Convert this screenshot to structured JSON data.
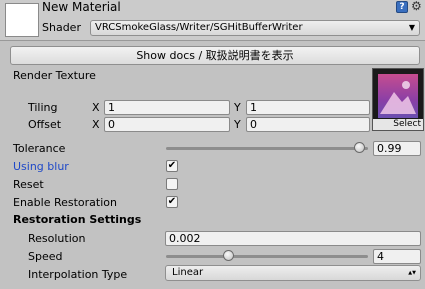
{
  "header": {
    "title": "New Material",
    "shader_label": "Shader",
    "shader_value": "VRCSmokeGlass/Writer/SGHitBufferWriter",
    "help_icon": "?"
  },
  "docs_button": "Show docs / 取扱説明書を表示",
  "render_texture": {
    "label": "Render Texture",
    "select": "Select",
    "tiling_label": "Tiling",
    "offset_label": "Offset",
    "tiling": {
      "x_label": "X",
      "x": "1",
      "y_label": "Y",
      "y": "1"
    },
    "offset": {
      "x_label": "X",
      "x": "0",
      "y_label": "Y",
      "y": "0"
    }
  },
  "tolerance": {
    "label": "Tolerance",
    "value": "0.99",
    "level": 0.99
  },
  "using_blur": {
    "label": "Using blur",
    "checked": true,
    "color": "#1f49c8"
  },
  "reset": {
    "label": "Reset",
    "checked": false
  },
  "enable_restoration": {
    "label": "Enable Restoration",
    "checked": true
  },
  "restoration_settings": {
    "heading": "Restoration Settings",
    "resolution": {
      "label": "Resolution",
      "value": "0.002"
    },
    "speed": {
      "label": "Speed",
      "value": "4",
      "level": 0.3
    },
    "interpolation": {
      "label": "Interpolation Type",
      "value": "Linear"
    }
  },
  "check_mark": "✔"
}
